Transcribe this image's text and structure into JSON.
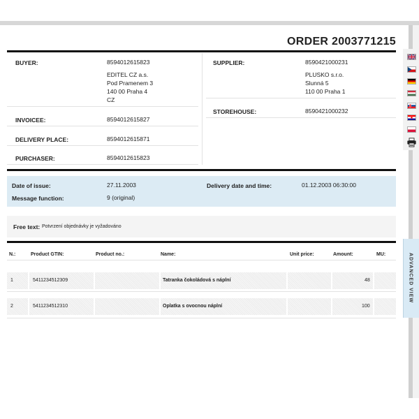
{
  "order": {
    "title": "ORDER 2003771215"
  },
  "buyer": {
    "label": "BUYER:",
    "gln": "8594012615823",
    "name": "EDITEL CZ a.s.",
    "street": "Pod Pramenem 3",
    "city": "140 00 Praha 4",
    "country": "CZ"
  },
  "invoicee": {
    "label": "INVOICEE:",
    "gln": "8594012615827"
  },
  "delivery_place": {
    "label": "DELIVERY PLACE:",
    "gln": "8594012615871"
  },
  "purchaser": {
    "label": "PURCHASER:",
    "gln": "8594012615823"
  },
  "supplier": {
    "label": "SUPPLIER:",
    "gln": "8590421000231",
    "name": "PLUSKO s.r.o.",
    "street": "Slunná 5",
    "city": "110 00 Praha 1"
  },
  "storehouse": {
    "label": "STOREHOUSE:",
    "gln": "8590421000232"
  },
  "info": {
    "issue_label": "Date of issue:",
    "issue_value": "27.11.2003",
    "function_label": "Message function:",
    "function_value": "9 (original)",
    "delivery_label": "Delivery date and time:",
    "delivery_value": "01.12.2003 06:30:00"
  },
  "free_text": {
    "label": "Free text:",
    "value": "Potvrzení objednávky je vyžadováno"
  },
  "table": {
    "headers": [
      "N.:",
      "Product GTIN:",
      "Product no.:",
      "Name:",
      "Unit price:",
      "Amount:",
      "MU:"
    ],
    "rows": [
      {
        "n": "1",
        "gtin": "5411234512309",
        "product_no": "",
        "name": "Tatranka čokoládová s náplní",
        "unit_price": "",
        "amount": "48",
        "mu": ""
      },
      {
        "n": "2",
        "gtin": "5411234512310",
        "product_no": "",
        "name": "Oplatka s ovocnou náplní",
        "unit_price": "",
        "amount": "100",
        "mu": ""
      }
    ]
  },
  "side": {
    "flags": [
      "uk-flag-icon",
      "czech-flag-icon",
      "german-flag-icon",
      "hungarian-flag-icon",
      "slovak-flag-icon",
      "croatian-flag-icon",
      "polish-flag-icon"
    ],
    "print_icon": "printer-icon",
    "advanced_view": "ADVANCED VIEW"
  }
}
